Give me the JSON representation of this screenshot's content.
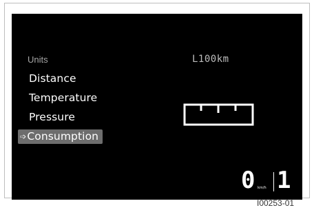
{
  "menu": {
    "title": "Units",
    "items": [
      {
        "label": "Distance",
        "selected": false
      },
      {
        "label": "Temperature",
        "selected": false
      },
      {
        "label": "Pressure",
        "selected": false
      },
      {
        "label": "Consumption",
        "selected": true
      }
    ],
    "selected_marker": "➩"
  },
  "setting": {
    "value": "L100km"
  },
  "status": {
    "speed": "0",
    "speed_unit": "km/h",
    "gear": "1"
  },
  "reference_code": "I00253-01",
  "colors": {
    "screen_background": "#000000",
    "selection_highlight": "#6d6d6d",
    "text_primary": "#ffffff",
    "text_secondary": "#a6a6a6"
  },
  "icons": {
    "gauge": "segmented-gauge-icon",
    "selection": "arrow-right-icon"
  }
}
